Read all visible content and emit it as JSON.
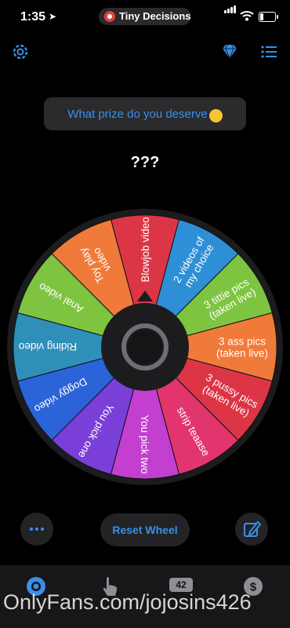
{
  "status_bar": {
    "time": "1:35",
    "app_name": "Tiny Decisions"
  },
  "header": {
    "icons": [
      "gear-icon",
      "diamond-icon",
      "list-icon"
    ]
  },
  "prompt": {
    "text": "What prize do you deserve",
    "emoji": "winking-face"
  },
  "result": {
    "text": "???"
  },
  "wheel": {
    "segments": [
      {
        "label": "Blowjob video",
        "color": "#dc3545"
      },
      {
        "label": "2 videos of my choice",
        "color": "#2f8fd6"
      },
      {
        "label": "3 tittie pics (taken live)",
        "color": "#7fc441"
      },
      {
        "label": "3 ass pics (taken live)",
        "color": "#f07a3a"
      },
      {
        "label": "3 pussy pics (taken live)",
        "color": "#dc3545"
      },
      {
        "label": "strip teaase",
        "color": "#e2356e"
      },
      {
        "label": "You pick two",
        "color": "#c23fd0"
      },
      {
        "label": "You pick one",
        "color": "#7a3fd8"
      },
      {
        "label": "Doggy video",
        "color": "#2b63d8"
      },
      {
        "label": "Riding video",
        "color": "#2f8fb8"
      },
      {
        "label": "Anal video",
        "color": "#7fc441"
      },
      {
        "label": "Toy play video",
        "color": "#f07a3a"
      }
    ]
  },
  "controls": {
    "more_icon": "ellipsis-icon",
    "reset_label": "Reset Wheel",
    "edit_icon": "edit-icon"
  },
  "tabbar": {
    "badge": "42",
    "icons": [
      "wheel-icon",
      "hand-pointer-icon",
      "counter-icon",
      "dollar-icon"
    ]
  },
  "watermark": "OnlyFans.com/jojosins426",
  "colors": {
    "accent": "#3a8fe8",
    "background": "#000000",
    "panel": "#232326"
  }
}
